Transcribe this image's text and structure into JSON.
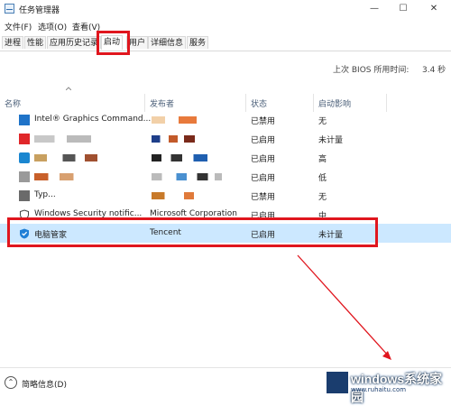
{
  "window": {
    "title": "任务管理器",
    "minimize": "—",
    "maximize": "☐",
    "close": "✕"
  },
  "menu": [
    "文件(F)",
    "选项(O)",
    "查看(V)"
  ],
  "tabs": [
    "进程",
    "性能",
    "应用历史记录",
    "启动",
    "用户",
    "详细信息",
    "服务"
  ],
  "active_tab": "启动",
  "bios": {
    "label": "上次 BIOS 所用时间:",
    "value": "3.4 秒"
  },
  "columns": {
    "name": "名称",
    "publisher": "发布者",
    "status": "状态",
    "impact": "启动影响"
  },
  "rows": [
    {
      "name": "Intel® Graphics Command...",
      "publisher": "",
      "status": "已禁用",
      "impact": "无"
    },
    {
      "name": "",
      "publisher": "",
      "status": "已启用",
      "impact": "未计量"
    },
    {
      "name": "",
      "publisher": "",
      "status": "已启用",
      "impact": "高"
    },
    {
      "name": "",
      "publisher": "",
      "status": "已启用",
      "impact": "低"
    },
    {
      "name": "Typ...",
      "publisher": "",
      "status": "已禁用",
      "impact": "无"
    },
    {
      "name": "Windows Security notific...",
      "publisher": "Microsoft Corporation",
      "status": "已启用",
      "impact": "中"
    },
    {
      "name": "电脑管家",
      "publisher": "Tencent",
      "status": "已启用",
      "impact": "未计量"
    }
  ],
  "footer": {
    "label": "简略信息(D)"
  },
  "watermark": {
    "main": "windows系统家园",
    "sub": "www.ruhaitu.com"
  },
  "colors": {
    "highlight": "#e0161e",
    "selected_row": "#cce8ff",
    "arrow": "#e0161e"
  }
}
